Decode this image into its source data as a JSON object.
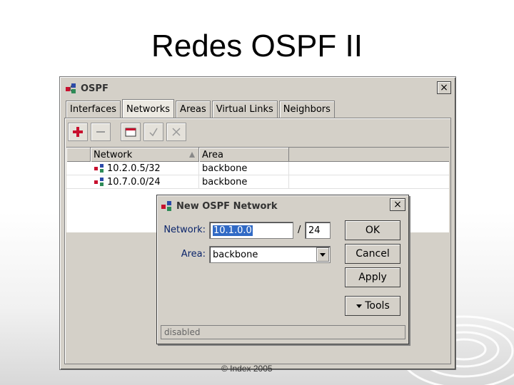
{
  "slide": {
    "title": "Redes OSPF II",
    "footer": "© Index 2005"
  },
  "window": {
    "title": "OSPF",
    "close_label": "×",
    "tabs": [
      {
        "label": "Interfaces",
        "active": false
      },
      {
        "label": "Networks",
        "active": true
      },
      {
        "label": "Areas",
        "active": false
      },
      {
        "label": "Virtual Links",
        "active": false
      },
      {
        "label": "Neighbors",
        "active": false
      }
    ],
    "toolbar": [
      {
        "name": "add-button",
        "icon": "plus-icon"
      },
      {
        "name": "remove-button",
        "icon": "minus-icon"
      },
      {
        "name": "comment-button",
        "icon": "comment-icon"
      },
      {
        "name": "enable-button",
        "icon": "check-icon"
      },
      {
        "name": "disable-button",
        "icon": "cross-icon"
      }
    ],
    "grid": {
      "columns": [
        "Network",
        "Area"
      ],
      "sort_column": "Network",
      "rows": [
        {
          "network": "10.2.0.5/32",
          "area": "backbone"
        },
        {
          "network": "10.7.0.0/24",
          "area": "backbone"
        }
      ]
    }
  },
  "dialog": {
    "title": "New OSPF Network",
    "close_label": "×",
    "network_label": "Network:",
    "network_value": "10.1.0.0",
    "slash": "/",
    "prefix_value": "24",
    "area_label": "Area:",
    "area_value": "backbone",
    "buttons": {
      "ok": "OK",
      "cancel": "Cancel",
      "apply": "Apply",
      "tools": "Tools"
    },
    "status": "disabled"
  },
  "colors": {
    "accent_red": "#c8102e",
    "selection_blue": "#316ac5",
    "label_blue": "#0a246a"
  }
}
